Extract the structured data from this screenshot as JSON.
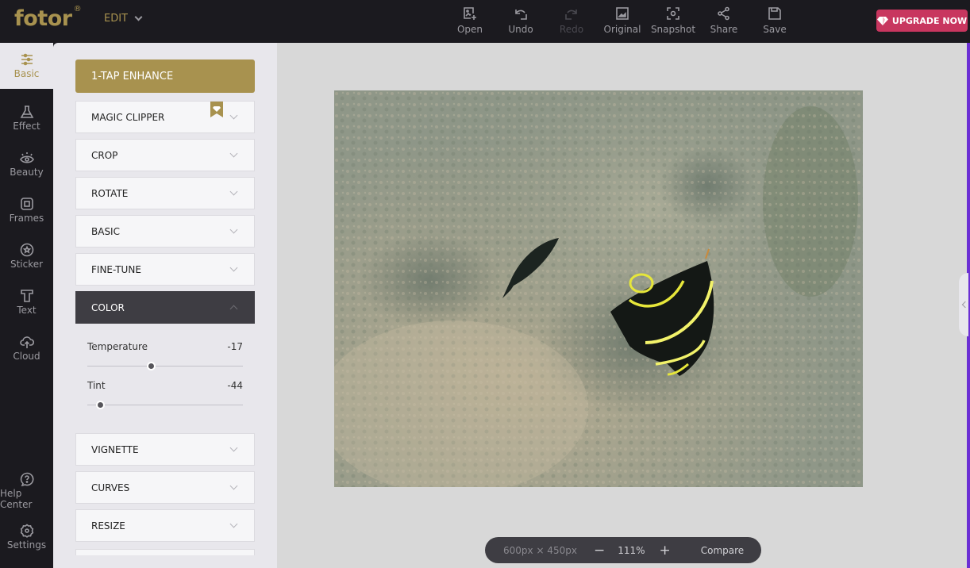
{
  "app": {
    "logo_text": "fotor",
    "logo_mark": "®",
    "mode_menu": "EDIT"
  },
  "toolbar": [
    {
      "label": "Open",
      "icon": "open-image-icon",
      "enabled": true
    },
    {
      "label": "Undo",
      "icon": "undo-icon",
      "enabled": true
    },
    {
      "label": "Redo",
      "icon": "redo-icon",
      "enabled": false
    },
    {
      "label": "Original",
      "icon": "original-image-icon",
      "enabled": true
    },
    {
      "label": "Snapshot",
      "icon": "snapshot-icon",
      "enabled": true
    },
    {
      "label": "Share",
      "icon": "share-icon",
      "enabled": true
    },
    {
      "label": "Save",
      "icon": "save-icon",
      "enabled": true
    }
  ],
  "upgrade": {
    "label": "UPGRADE NOW",
    "icon": "diamond-icon",
    "color": "#c8365f"
  },
  "leftnav": {
    "items": [
      {
        "label": "Basic",
        "icon": "sliders-icon",
        "active": true
      },
      {
        "label": "Effect",
        "icon": "flask-icon"
      },
      {
        "label": "Beauty",
        "icon": "eye-icon"
      },
      {
        "label": "Frames",
        "icon": "frame-icon"
      },
      {
        "label": "Sticker",
        "icon": "star-circle-icon"
      },
      {
        "label": "Text",
        "icon": "text-icon"
      },
      {
        "label": "Cloud",
        "icon": "cloud-upload-icon"
      }
    ],
    "bottom": [
      {
        "label": "Help Center",
        "icon": "help-icon"
      },
      {
        "label": "Settings",
        "icon": "gear-icon"
      }
    ]
  },
  "panel": {
    "enhance_label": "1-TAP ENHANCE",
    "sections": [
      {
        "label": "MAGIC CLIPPER",
        "premium": true
      },
      {
        "label": "CROP"
      },
      {
        "label": "ROTATE"
      },
      {
        "label": "BASIC"
      },
      {
        "label": "FINE-TUNE"
      },
      {
        "label": "COLOR",
        "open": true
      },
      {
        "label": "VIGNETTE"
      },
      {
        "label": "CURVES"
      },
      {
        "label": "RESIZE"
      }
    ],
    "color_controls": [
      {
        "label": "Temperature",
        "value": "-17",
        "fraction": 0.41
      },
      {
        "label": "Tint",
        "value": "-44",
        "fraction": 0.08
      }
    ]
  },
  "canvas": {
    "image_description": "Underwater photo of coral reef with a French angelfish (black with yellow stripes) and a small dark fish",
    "dimensions": "600px × 450px",
    "zoom": "111%",
    "compare_label": "Compare",
    "accent": "#a8924f"
  }
}
